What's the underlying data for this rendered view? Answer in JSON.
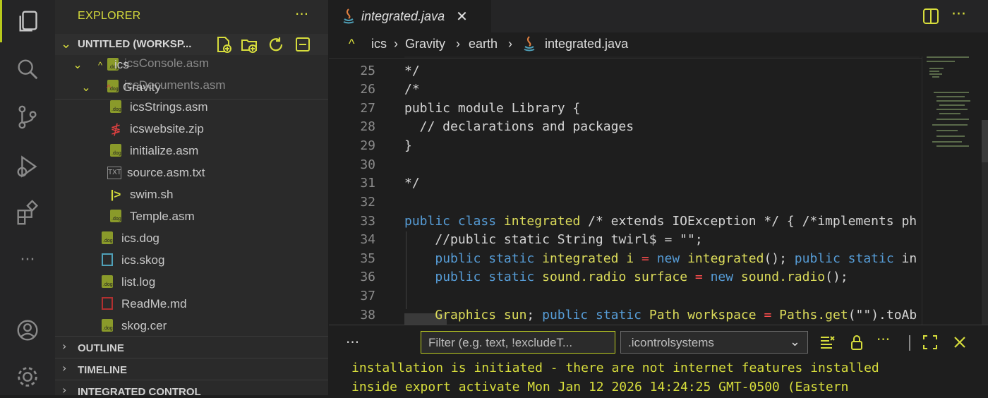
{
  "sidebar": {
    "title": "EXPLORER",
    "more": "···",
    "workspace_label": "UNTITLED (WORKSP...",
    "tree": [
      {
        "label": "icsStrings.asm",
        "icon": "dog-file-icon"
      },
      {
        "label": "icswebsite.zip",
        "icon": "zip-icon"
      },
      {
        "label": "initialize.asm",
        "icon": "dog-file-icon"
      },
      {
        "label": "source.asm.txt",
        "icon": "txt-icon"
      },
      {
        "label": "swim.sh",
        "icon": "shell-icon"
      },
      {
        "label": "Temple.asm",
        "icon": "dog-file-icon"
      },
      {
        "label": "ics.dog",
        "icon": "dog-file-icon"
      },
      {
        "label": "ics.skog",
        "icon": "skog-icon"
      },
      {
        "label": "list.log",
        "icon": "dog-file-icon"
      },
      {
        "label": "ReadMe.md",
        "icon": "markdown-icon"
      },
      {
        "label": "skog.cer",
        "icon": "dog-file-icon"
      }
    ],
    "folder_ics": "ics",
    "folder_gravity": "Gravity",
    "ghost_file_1": "icsConsole.asm",
    "ghost_file_2": "icsDocuments.asm",
    "sections": [
      "OUTLINE",
      "TIMELINE",
      "INTEGRATED CONTROL"
    ]
  },
  "tab": {
    "label": "integrated.java",
    "close": "✕"
  },
  "breadcrumb": {
    "items": [
      "ics",
      "Gravity",
      "earth",
      "integrated.java"
    ]
  },
  "editor": {
    "lines": [
      {
        "n": "25",
        "t": "*/"
      },
      {
        "n": "26",
        "t": "/*"
      },
      {
        "n": "27",
        "t": "public module Library {"
      },
      {
        "n": "28",
        "t": "  // declarations and packages"
      },
      {
        "n": "29",
        "t": "}"
      },
      {
        "n": "30",
        "t": ""
      },
      {
        "n": "31",
        "t": "*/"
      },
      {
        "n": "32",
        "t": ""
      },
      {
        "n": "33",
        "t": "public class integrated /* extends IOException */ { /*implements ph"
      },
      {
        "n": "34",
        "t": "    //public static String twirl$ = \"\";"
      },
      {
        "n": "35",
        "t": "    public static integrated i = new integrated(); public static in"
      },
      {
        "n": "36",
        "t": "    public static sound.radio surface = new sound.radio();"
      },
      {
        "n": "37",
        "t": ""
      },
      {
        "n": "38",
        "t": "    Graphics sun; public static Path workspace = Paths.get(\"\").toAb"
      }
    ]
  },
  "panel": {
    "more": "···",
    "filter_placeholder": "Filter (e.g. text, !excludeT...",
    "channel": ".icontrolsystems",
    "output_line1": "installation is initiated - there are not internet features installed",
    "output_line2": "inside export activate Mon Jan 12 2026 14:24:25 GMT-0500 (Eastern"
  },
  "colors": {
    "accent": "#d7dd3c",
    "background": "#1e1e1e",
    "sidebar": "#2a2a2a"
  }
}
